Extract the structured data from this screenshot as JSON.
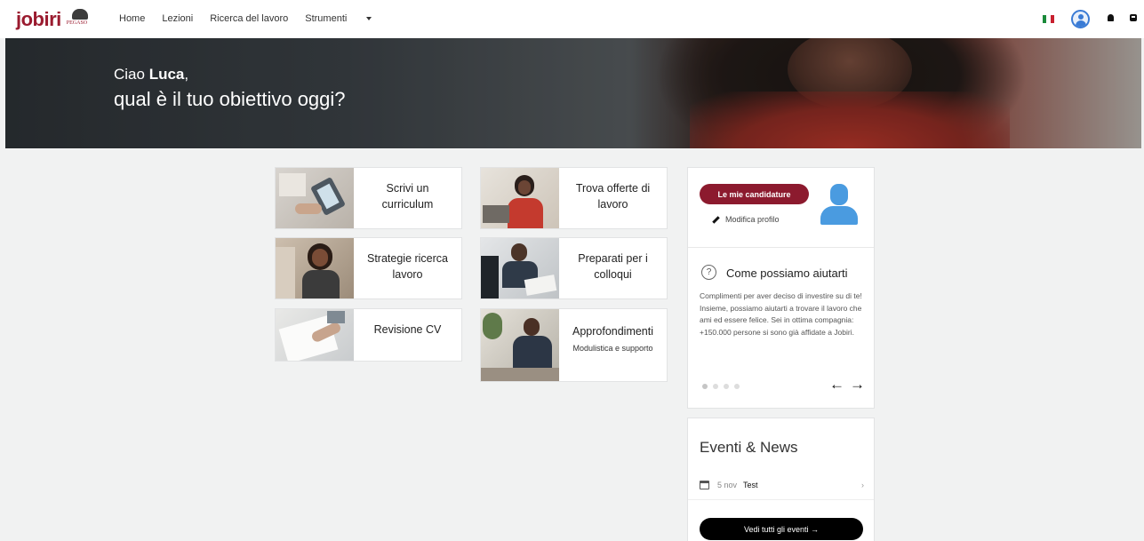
{
  "nav": {
    "logo": "jobiri",
    "partner_logo": "PEGASO",
    "items": [
      {
        "label": "Home"
      },
      {
        "label": "Lezioni"
      },
      {
        "label": "Ricerca del lavoro"
      },
      {
        "label": "Strumenti"
      }
    ],
    "icons": [
      "italy-flag-icon",
      "user-icon",
      "bell-icon",
      "message-icon"
    ]
  },
  "hero": {
    "greeting_prefix": "Ciao",
    "user_name": "Luca",
    "greeting_suffix": ",",
    "question": "qual è il tuo obiettivo oggi?"
  },
  "tiles": [
    {
      "label": "Scrivi un curriculum",
      "sub": ""
    },
    {
      "label": "Trova offerte di lavoro",
      "sub": ""
    },
    {
      "label": "Strategie ricerca lavoro",
      "sub": ""
    },
    {
      "label": "Preparati per i colloqui",
      "sub": ""
    },
    {
      "label": "Revisione CV",
      "sub": ""
    },
    {
      "label": "Approfondimenti",
      "sub": "Modulistica e supporto"
    }
  ],
  "profile": {
    "applications_button": "Le mie candidature",
    "edit_profile": "Modifica profilo"
  },
  "help": {
    "icon_text": "?",
    "title": "Come possiamo aiutarti",
    "text": "Complimenti per aver deciso di investire su di te! Insieme, possiamo aiutarti a trovare il lavoro che ami ed essere felice. Sei in ottima compagnia: +150.000 persone si sono già affidate a Jobiri.",
    "carousel_pages": 4,
    "carousel_active": 1,
    "prev": "←",
    "next": "→"
  },
  "events": {
    "title": "Eventi & News",
    "items": [
      {
        "date": "5 nov",
        "name": "Test",
        "chevron": "›"
      }
    ],
    "all_button": "Vedi tutti gli eventi →"
  },
  "colors": {
    "brand": "#8c1a2e",
    "avatar": "#4a9be0",
    "background": "#f1f2f2"
  }
}
